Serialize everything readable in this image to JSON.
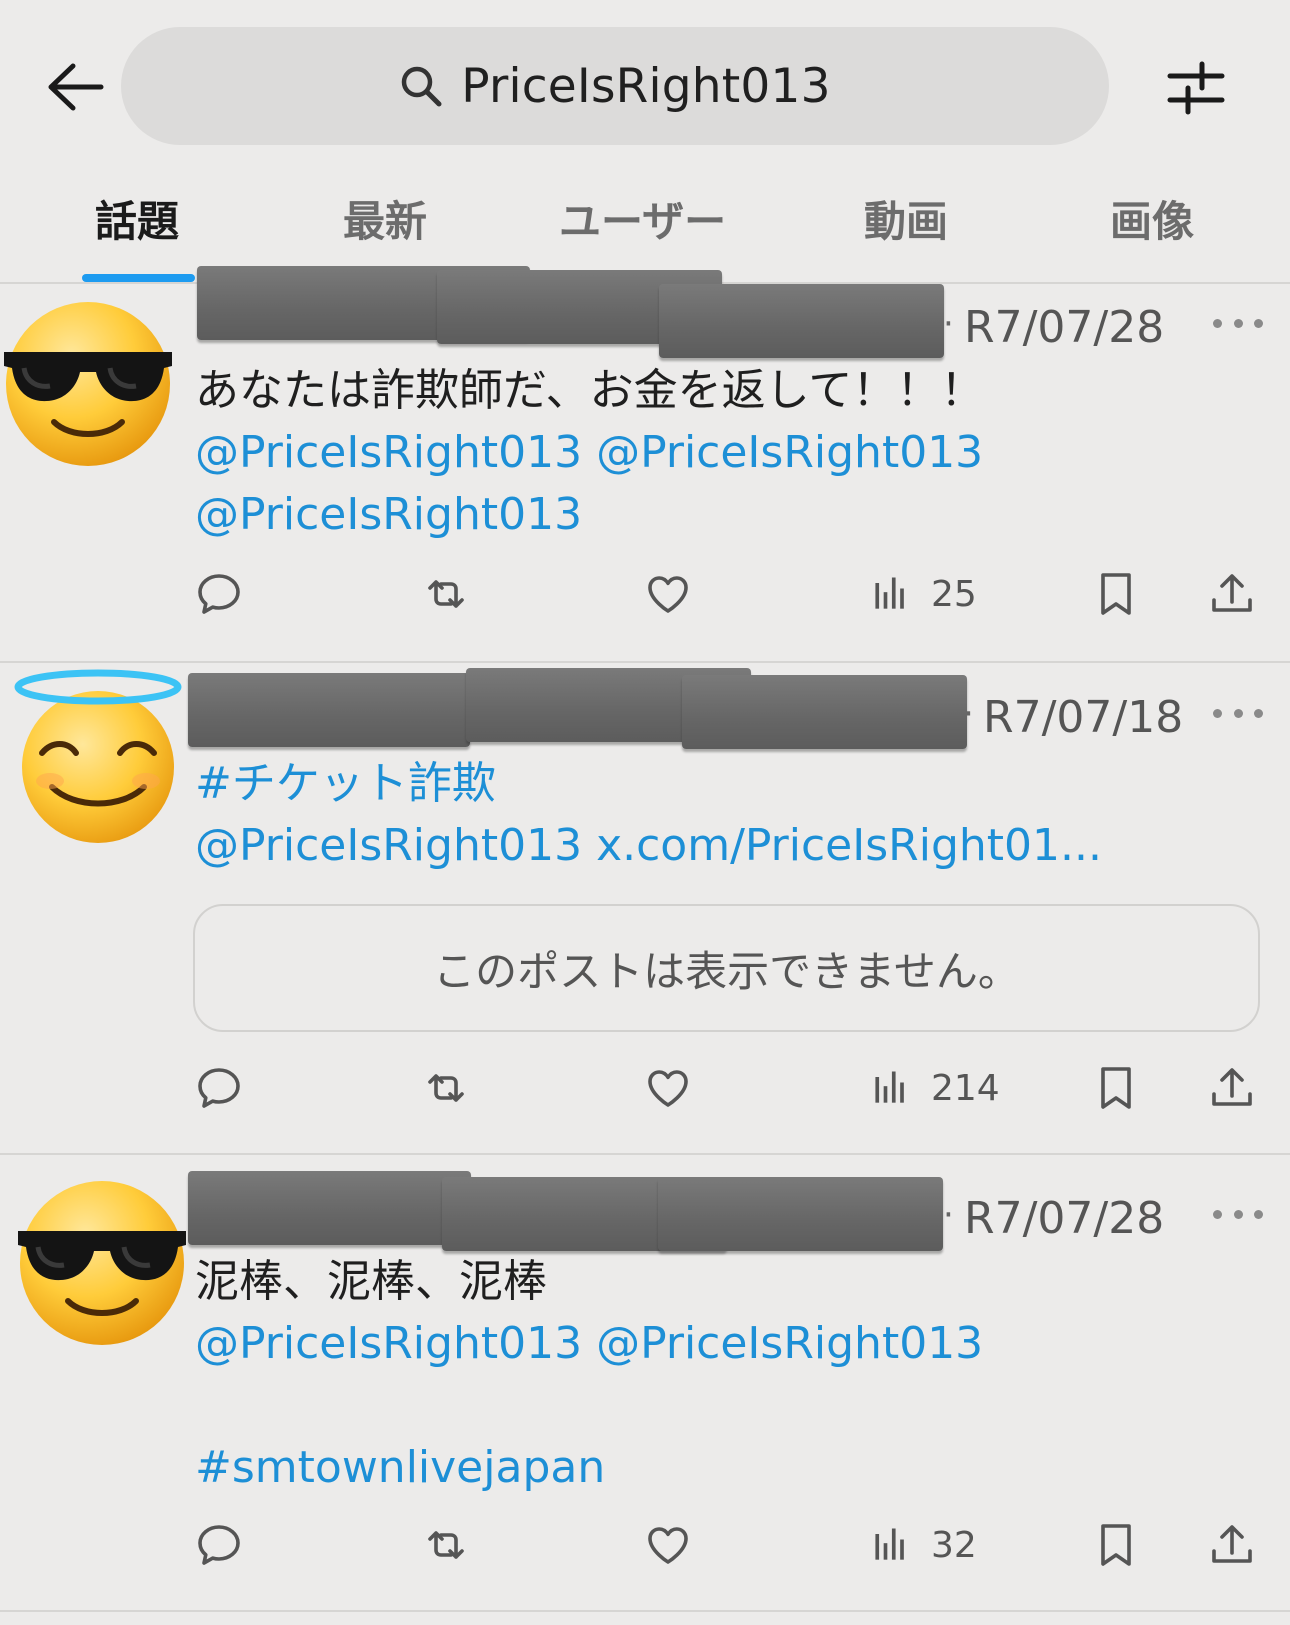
{
  "search": {
    "query": "PriceIsRight013"
  },
  "tabs": [
    {
      "label": "話題"
    },
    {
      "label": "最新"
    },
    {
      "label": "ユーザー"
    },
    {
      "label": "動画"
    },
    {
      "label": "画像"
    }
  ],
  "active_tab": 0,
  "posts": [
    {
      "avatar": "sunglasses-emoji",
      "date": "R7/07/28",
      "dot": "·",
      "text": "あなたは詐欺師だ、お金を返して！！！",
      "mentions_line1a": "@PriceIsRight013",
      "mentions_line1b": "@PriceIsRight013",
      "mentions_line2": "@PriceIsRight013",
      "views": "25"
    },
    {
      "avatar": "halo-emoji",
      "date": "R7/07/18",
      "dot": "·",
      "hashtag": "#チケット詐欺",
      "mention": "@PriceIsRight013",
      "url": "x.com/PriceIsRight01...",
      "unavailable": "このポストは表示できません。",
      "views": "214"
    },
    {
      "avatar": "sunglasses-emoji",
      "date": "R7/07/28",
      "dot": "·",
      "text": "泥棒、泥棒、泥棒",
      "mention_a": "@PriceIsRight013",
      "mention_b": "@PriceIsRight013",
      "hashtag": "#smtownlivejapan",
      "views": "32"
    }
  ],
  "colors": {
    "link": "#1d8fd6",
    "accent": "#1d9bf0",
    "background": "#ecebea"
  }
}
